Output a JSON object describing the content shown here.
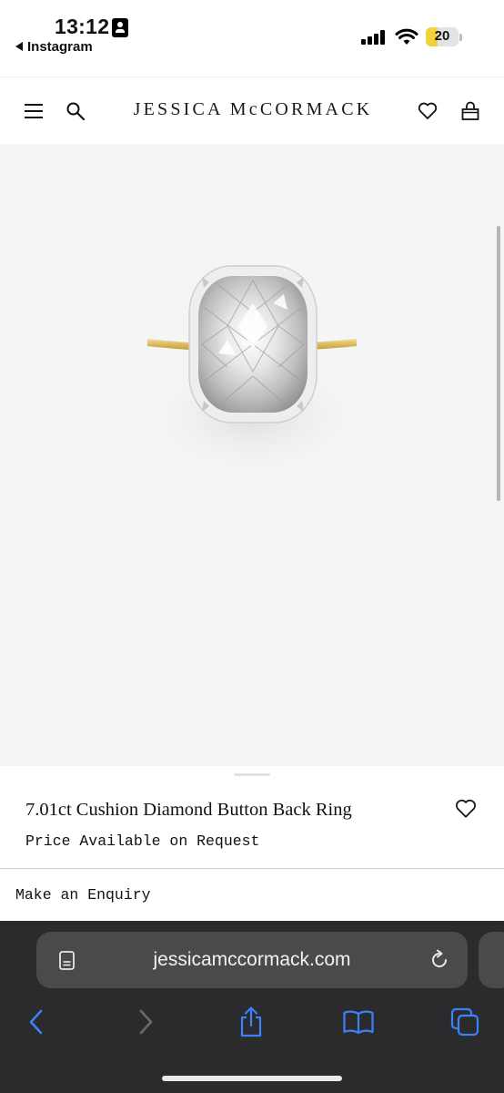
{
  "status_bar": {
    "time": "13:12",
    "back_app": "Instagram",
    "battery": "20"
  },
  "header": {
    "brand": "JESSICA McCORMACK",
    "icons": [
      "menu-icon",
      "search-icon",
      "heart-icon",
      "bag-icon"
    ]
  },
  "product": {
    "title": "7.01ct Cushion Diamond Button Back Ring",
    "price": "Price Available on Request",
    "enquiry_label": "Make an Enquiry"
  },
  "browser": {
    "url": "jessicamccormack.com",
    "toolbar_icons": [
      "back-icon",
      "forward-icon",
      "share-icon",
      "bookmarks-icon",
      "tabs-icon"
    ],
    "accent": "#3a82f7"
  }
}
